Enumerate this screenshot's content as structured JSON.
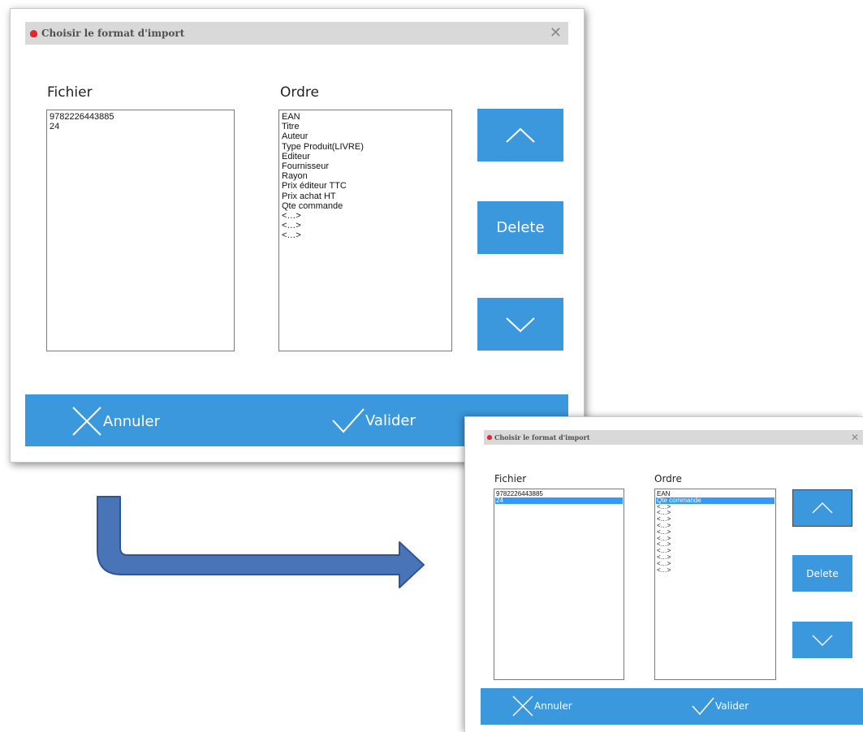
{
  "dialog_before": {
    "title": "Choisir le format d'import",
    "close_glyph": "✕",
    "fichier_label": "Fichier",
    "ordre_label": "Ordre",
    "fichier_items": [
      "9782226443885",
      "24"
    ],
    "ordre_items": [
      "EAN",
      "Titre",
      "Auteur",
      "Type Produit(LIVRE)",
      "Editeur",
      "Fournisseur",
      "Rayon",
      "Prix éditeur TTC",
      "Prix achat HT",
      "Qte commande",
      "<…>",
      "<…>",
      "<…>"
    ],
    "delete_label": "Delete",
    "cancel_label": "Annuler",
    "validate_label": "Valider"
  },
  "dialog_after": {
    "title": "Choisir le format d'import",
    "close_glyph": "✕",
    "fichier_label": "Fichier",
    "ordre_label": "Ordre",
    "fichier_items": [
      "9782226443885",
      "24"
    ],
    "fichier_selected_index": 1,
    "ordre_items": [
      "EAN",
      "Qte commande",
      "<…>",
      "<…>",
      "<…>",
      "<…>",
      "<…>",
      "<…>",
      "<…>",
      "<…>",
      "<…>",
      "<…>",
      "<…>"
    ],
    "ordre_selected_index": 1,
    "delete_label": "Delete",
    "cancel_label": "Annuler",
    "validate_label": "Valider"
  },
  "colors": {
    "accent": "#3b98dc",
    "selection": "#3399ff",
    "titlebar": "#d9d9d9",
    "transition_arrow": "#4a74b8"
  },
  "icons": {
    "up": "chevron-up-icon",
    "down": "chevron-down-icon",
    "cancel": "close-icon",
    "validate": "check-icon",
    "app": "app-logo-icon",
    "transition": "bent-arrow-icon"
  }
}
